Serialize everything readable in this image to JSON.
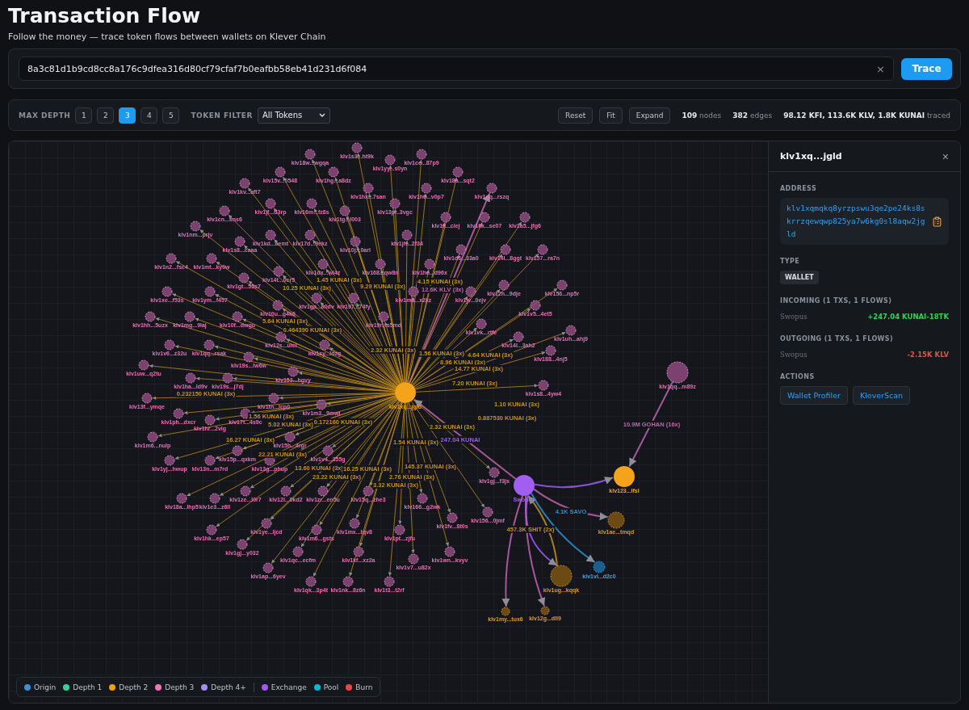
{
  "header": {
    "title": "Transaction Flow",
    "subtitle": "Follow the money — trace token flows between wallets on Klever Chain"
  },
  "search": {
    "value": "8a3c81d1b9cd8cc8a176c9dfea316d80cf79cfaf7b0eafbb58eb41d231d6f084",
    "clear": "×",
    "button": "Trace"
  },
  "controls": {
    "depth_label": "MAX DEPTH",
    "depths": [
      {
        "label": "1",
        "selected": false
      },
      {
        "label": "2",
        "selected": false
      },
      {
        "label": "3",
        "selected": true
      },
      {
        "label": "4",
        "selected": false
      },
      {
        "label": "5",
        "selected": false
      }
    ],
    "token_label": "TOKEN FILTER",
    "token_value": "All Tokens",
    "buttons": [
      "Reset",
      "Fit",
      "Expand"
    ],
    "stats": [
      "**109** nodes",
      "**382** edges",
      "**98.12 KFI, 113.6K KLV, 1.8K KUNAI** traced"
    ]
  },
  "graph": {
    "nodes": [
      {
        "label": "klv1s3...ht9k",
        "kind": "depth3"
      },
      {
        "label": "klv18w...wgqa",
        "kind": "depth3"
      },
      {
        "label": "klv1ce...87p9",
        "kind": "depth3"
      },
      {
        "label": "klv1yy...s0yn",
        "kind": "depth3"
      },
      {
        "label": "klv15v...0548",
        "kind": "depth3"
      },
      {
        "label": "klv1hg...a8dz",
        "kind": "depth3"
      },
      {
        "label": "klv18a...sqt2",
        "kind": "depth3"
      },
      {
        "label": "klv1kv...aft7",
        "kind": "depth3"
      },
      {
        "label": "klv1hx...7san",
        "kind": "depth3"
      },
      {
        "label": "klv1h6...v0p7",
        "kind": "depth3"
      },
      {
        "label": "klv1qq...rszq",
        "kind": "depth3"
      },
      {
        "label": "klv1jf...d3rp",
        "kind": "depth3"
      },
      {
        "label": "klv16m...fz8s",
        "kind": "depth3"
      },
      {
        "label": "klv13p...3vgc",
        "kind": "depth3"
      },
      {
        "label": "klv1cn...sns6",
        "kind": "depth3"
      },
      {
        "label": "klv1tg...l003",
        "kind": "depth3"
      },
      {
        "label": "klv1ll...clej",
        "kind": "depth3"
      },
      {
        "label": "klv1kk...se07",
        "kind": "depth3"
      },
      {
        "label": "klv1a5...jfg6",
        "kind": "depth3"
      },
      {
        "label": "klv1nm...prjv",
        "kind": "depth3"
      },
      {
        "label": "klv1kd...aemt",
        "kind": "depth3"
      },
      {
        "label": "klv17d...9ekz",
        "kind": "depth3"
      },
      {
        "label": "klv1jh...2f34",
        "kind": "depth3"
      },
      {
        "label": "klv1s8...caaa",
        "kind": "depth3"
      },
      {
        "label": "klv10j...0arl",
        "kind": "depth3"
      },
      {
        "label": "klv1d6...33a0",
        "kind": "depth3"
      },
      {
        "label": "klv14l...8ggt",
        "kind": "depth3"
      },
      {
        "label": "klv157...ra7n",
        "kind": "depth3"
      },
      {
        "label": "klv1n2...fsc4",
        "kind": "depth3"
      },
      {
        "label": "klv1mt...ky0w",
        "kind": "depth3"
      },
      {
        "label": "klv1dx...wl4z",
        "kind": "depth3"
      },
      {
        "label": "klv168...qw8n",
        "kind": "depth3"
      },
      {
        "label": "klv1hc...d96x",
        "kind": "depth3"
      },
      {
        "label": "klv14t...0cr5",
        "kind": "depth3"
      },
      {
        "label": "klv1gt...55s7",
        "kind": "depth3"
      },
      {
        "label": "klv12h...9dje",
        "kind": "depth3"
      },
      {
        "label": "klv156...np5r",
        "kind": "depth3"
      },
      {
        "label": "klv1xe...f53s",
        "kind": "depth3"
      },
      {
        "label": "klv1ym...f457",
        "kind": "depth3"
      },
      {
        "label": "klv1m3...x2kz",
        "kind": "depth3"
      },
      {
        "label": "klv1jv...0ejv",
        "kind": "depth3"
      },
      {
        "label": "klv1ga...a0dv",
        "kind": "depth3"
      },
      {
        "label": "klv197...74fy",
        "kind": "depth3"
      },
      {
        "label": "klv10u...g4k6",
        "kind": "depth3"
      },
      {
        "label": "klv1v5...4et5",
        "kind": "depth3"
      },
      {
        "label": "klv1hh...5uzx",
        "kind": "depth3"
      },
      {
        "label": "klv1mg...9laj",
        "kind": "depth3"
      },
      {
        "label": "klv10f...dwgu",
        "kind": "depth3"
      },
      {
        "label": "klv19r...s5md",
        "kind": "depth3"
      },
      {
        "label": "klv1vk...rtfe",
        "kind": "depth3"
      },
      {
        "label": "klv1uh...ahj9",
        "kind": "depth3"
      },
      {
        "label": "klv12s...uicl",
        "kind": "depth3"
      },
      {
        "label": "klv14l...3ah2",
        "kind": "depth3"
      },
      {
        "label": "klv1v6...z32u",
        "kind": "depth3"
      },
      {
        "label": "klv1qq...rsak",
        "kind": "depth3"
      },
      {
        "label": "klv1sy...ldzg",
        "kind": "depth3"
      },
      {
        "label": "klv188...4nj5",
        "kind": "depth3"
      },
      {
        "label": "klv19s...lw6w",
        "kind": "depth3"
      },
      {
        "label": "klv1uw...q2tu",
        "kind": "depth3"
      },
      {
        "label": "klv153...hgvy",
        "kind": "depth3"
      },
      {
        "label": "klv1ha...ld9v",
        "kind": "depth3"
      },
      {
        "label": "klv19s...j7dj",
        "kind": "depth3"
      },
      {
        "label": "klv1qq...m89z",
        "kind": "depth3"
      },
      {
        "label": "klv1s8...4yw4",
        "kind": "depth3"
      },
      {
        "label": "klv13f...ymqe",
        "kind": "depth3"
      },
      {
        "label": "klv1tn...lcp0",
        "kind": "depth3"
      },
      {
        "label": "klv1xq...jgld",
        "kind": "depth2"
      },
      {
        "label": "klv1m3...9mwl",
        "kind": "depth3"
      },
      {
        "label": "klv1ph...dxcr",
        "kind": "depth3"
      },
      {
        "label": "klv17t...4s9c",
        "kind": "depth3"
      },
      {
        "label": "klv1hr...2vlg",
        "kind": "depth3"
      },
      {
        "label": "klv1m6...nulp",
        "kind": "depth3"
      },
      {
        "label": "klv15h...4rgr",
        "kind": "depth3"
      },
      {
        "label": "klv15p...qxkm",
        "kind": "depth3"
      },
      {
        "label": "klv1v4...355g",
        "kind": "depth3"
      },
      {
        "label": "klv1yj...hwup",
        "kind": "depth3"
      },
      {
        "label": "klv13n...m7rd",
        "kind": "depth3"
      },
      {
        "label": "klv13g...phup",
        "kind": "depth3"
      },
      {
        "label": "klv1gj...f3js",
        "kind": "depth3"
      },
      {
        "label": "klv123...lfsl",
        "kind": "depth2"
      },
      {
        "label": "klv1ze...l0r7",
        "kind": "depth3"
      },
      {
        "label": "klv12l...0kd2",
        "kind": "depth3"
      },
      {
        "label": "klv1zr...en5u",
        "kind": "depth3"
      },
      {
        "label": "klv15q...zhe3",
        "kind": "depth3"
      },
      {
        "label": "Swopus",
        "kind": "exchange"
      },
      {
        "label": "klv18a...lhp5",
        "kind": "depth3"
      },
      {
        "label": "klv1e3...z6ll",
        "kind": "depth3"
      },
      {
        "label": "klv166...g2wk",
        "kind": "depth3"
      },
      {
        "label": "klv156...0jmf",
        "kind": "depth3"
      },
      {
        "label": "klv1fv...8t0s",
        "kind": "depth3"
      },
      {
        "label": "klv1ye...ljcd",
        "kind": "depth3"
      },
      {
        "label": "klv1mx...tqv8",
        "kind": "depth3"
      },
      {
        "label": "klv1ae...tmqd",
        "kind": "faded"
      },
      {
        "label": "klv1hk...ep57",
        "kind": "depth3"
      },
      {
        "label": "klv1m6...gsts",
        "kind": "depth3"
      },
      {
        "label": "klv1pt...zjfu",
        "kind": "depth3"
      },
      {
        "label": "klv1gj...y032",
        "kind": "depth3"
      },
      {
        "label": "klv1qc...ecfm",
        "kind": "depth3"
      },
      {
        "label": "klv1kf...xz2a",
        "kind": "depth3"
      },
      {
        "label": "klv1wn...kvyv",
        "kind": "depth3"
      },
      {
        "label": "klv1v7...u82x",
        "kind": "depth3"
      },
      {
        "label": "klv1ap...6yev",
        "kind": "depth3"
      },
      {
        "label": "klv1vl...d2c0",
        "kind": "origin"
      },
      {
        "label": "klv1qk...3p4t",
        "kind": "depth3"
      },
      {
        "label": "klv1nk...8z6n",
        "kind": "depth3"
      },
      {
        "label": "klv1t3...t2rf",
        "kind": "depth3"
      },
      {
        "label": "klv1ug...kqqk",
        "kind": "faded"
      },
      {
        "label": "klv1my...tux6",
        "kind": "faded"
      },
      {
        "label": "klv12g...dll9",
        "kind": "faded"
      }
    ],
    "edge_labels": [
      {
        "text": "1.45 KUNAI (3x)",
        "color": "#c8901c"
      },
      {
        "text": "4.15 KUNAI (3x)",
        "color": "#c8901c"
      },
      {
        "text": "10.25 KUNAI (3x)",
        "color": "#c8901c"
      },
      {
        "text": "9.29 KUNAI (3x)",
        "color": "#c8901c"
      },
      {
        "text": "12.6K KLV (3x)",
        "color": "#c064b0"
      },
      {
        "text": "5.64 KUNAI (3x)",
        "color": "#c8901c"
      },
      {
        "text": "0.464390 KUNAI (3x)",
        "color": "#c8901c"
      },
      {
        "text": "2.32 KUNAI (3x)",
        "color": "#c8901c"
      },
      {
        "text": "1.56 KUNAI (3x)",
        "color": "#c8901c"
      },
      {
        "text": "4.64 KUNAI (3x)",
        "color": "#c8901c"
      },
      {
        "text": "8.96 KUNAI (3x)",
        "color": "#c8901c"
      },
      {
        "text": "14.77 KUNAI (3x)",
        "color": "#c8901c"
      },
      {
        "text": "7.20 KUNAI (3x)",
        "color": "#c8901c"
      },
      {
        "text": "0.232150 KUNAI (3x)",
        "color": "#c8901c"
      },
      {
        "text": "1.10 KUNAI (3x)",
        "color": "#c8901c"
      },
      {
        "text": "1.56 KUNAI (3x)",
        "color": "#c8901c"
      },
      {
        "text": "5.02 KUNAI (3x)",
        "color": "#c8901c"
      },
      {
        "text": "0.172160 KUNAI (3x)",
        "color": "#c8901c"
      },
      {
        "text": "2.32 KUNAI (3x)",
        "color": "#c8901c"
      },
      {
        "text": "0.887530 KUNAI (3x)",
        "color": "#c8901c"
      },
      {
        "text": "10.9M GOHAN (16x)",
        "color": "#c064b0"
      },
      {
        "text": "16.27 KUNAI (3x)",
        "color": "#c8901c"
      },
      {
        "text": "1.54 KUNAI (3x)",
        "color": "#c8901c"
      },
      {
        "text": "247.04 KUNAI",
        "color": "#9d5cf0"
      },
      {
        "text": "22.21 KUNAI (3x)",
        "color": "#c8901c"
      },
      {
        "text": "13.60 KUNAI (3x)",
        "color": "#c8901c"
      },
      {
        "text": "16.25 KUNAI (3x)",
        "color": "#c8901c"
      },
      {
        "text": "145.37 KUNAI (3x)",
        "color": "#c8901c"
      },
      {
        "text": "23.22 KUNAI (3x)",
        "color": "#c8901c"
      },
      {
        "text": "2.76 KUNAI (3x)",
        "color": "#c8901c"
      },
      {
        "text": "3.32 KUNAI (3x)",
        "color": "#c8901c"
      },
      {
        "text": "4.1K SAVO",
        "color": "#2b8fd0"
      },
      {
        "text": "457.3K SHIT (2x)",
        "color": "#c8901c"
      }
    ]
  },
  "legend": {
    "depths": [
      {
        "label": "Origin",
        "color": "#3b8fd9"
      },
      {
        "label": "Depth 1",
        "color": "#34d399"
      },
      {
        "label": "Depth 2",
        "color": "#f59e0b"
      },
      {
        "label": "Depth 3",
        "color": "#f472b6"
      },
      {
        "label": "Depth 4+",
        "color": "#a78bfa"
      }
    ],
    "types": [
      {
        "label": "Exchange",
        "color": "#a855f7"
      },
      {
        "label": "Pool",
        "color": "#06b6d4"
      },
      {
        "label": "Burn",
        "color": "#ef4444"
      }
    ]
  },
  "panel": {
    "title": "klv1xq...jgld",
    "close": "×",
    "address_label": "ADDRESS",
    "address": "klv1xqmqkq8yrzpswu3qe2pe24ks8skrrzqewqwp825ya7w6kg0sl8aqw2jgld",
    "type_label": "TYPE",
    "type": "WALLET",
    "incoming_label": "INCOMING (1 TXS, 1 FLOWS)",
    "incoming": [
      {
        "name": "Swopus",
        "amount": "+247.04 KUNAI-18TK"
      }
    ],
    "outgoing_label": "OUTGOING (1 TXS, 1 FLOWS)",
    "outgoing": [
      {
        "name": "Swopus",
        "amount": "-2.15K KLV"
      }
    ],
    "actions_label": "ACTIONS",
    "actions": [
      "Wallet Profiler",
      "KleverScan"
    ]
  }
}
